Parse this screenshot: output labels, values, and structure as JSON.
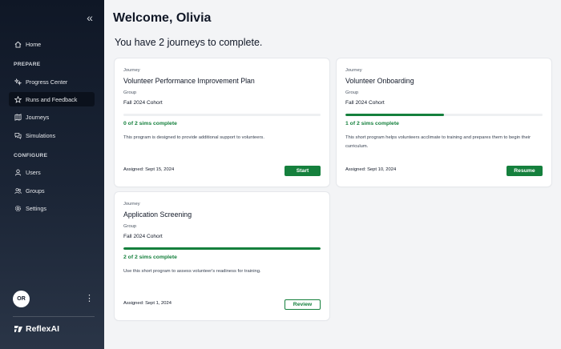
{
  "sidebar": {
    "collapse_icon": "«",
    "home": "Home",
    "prepare_label": "PREPARE",
    "progress_center": "Progress Center",
    "runs_and_feedback": "Runs and Feedback",
    "journeys": "Journeys",
    "simulations": "Simulations",
    "configure_label": "CONFIGURE",
    "users": "Users",
    "groups": "Groups",
    "settings": "Settings",
    "avatar_initials": "OR",
    "menu_icon": "⋮",
    "logo_text": "ReflexAI"
  },
  "header": {
    "welcome": "Welcome, Olivia",
    "subtitle": "You have 2 journeys to complete."
  },
  "cards": [
    {
      "type_label": "Journey",
      "title": "Volunteer Performance Improvement Plan",
      "group_label": "Group",
      "group": "Fall 2024 Cohort",
      "progress_fraction": 0,
      "progress_text": "0 of 2 sims complete",
      "description": "This program is designed to provide additional support to volunteers.",
      "assigned": "Assigned: Sept 15, 2024",
      "action": "Start"
    },
    {
      "type_label": "Journey",
      "title": "Volunteer Onboarding",
      "group_label": "Group",
      "group": "Fall 2024 Cohort",
      "progress_fraction": 0.5,
      "progress_text": "1 of 2 sims complete",
      "description": "This short program helps volunteers acclimate to training and prepares them to begin their curriculum.",
      "assigned": "Assigned: Sept 10, 2024",
      "action": "Resume"
    },
    {
      "type_label": "Journey",
      "title": "Application Screening",
      "group_label": "Group",
      "group": "Fall 2024 Cohort",
      "progress_fraction": 1,
      "progress_text": "2 of 2 sims complete",
      "description": "Use this short program to assess volunteer's readiness for training.",
      "assigned": "Assigned: Sept 1, 2024",
      "action": "Review"
    }
  ],
  "colors": {
    "accent_green": "#15803d",
    "sidebar_dark": "#0f1726"
  }
}
